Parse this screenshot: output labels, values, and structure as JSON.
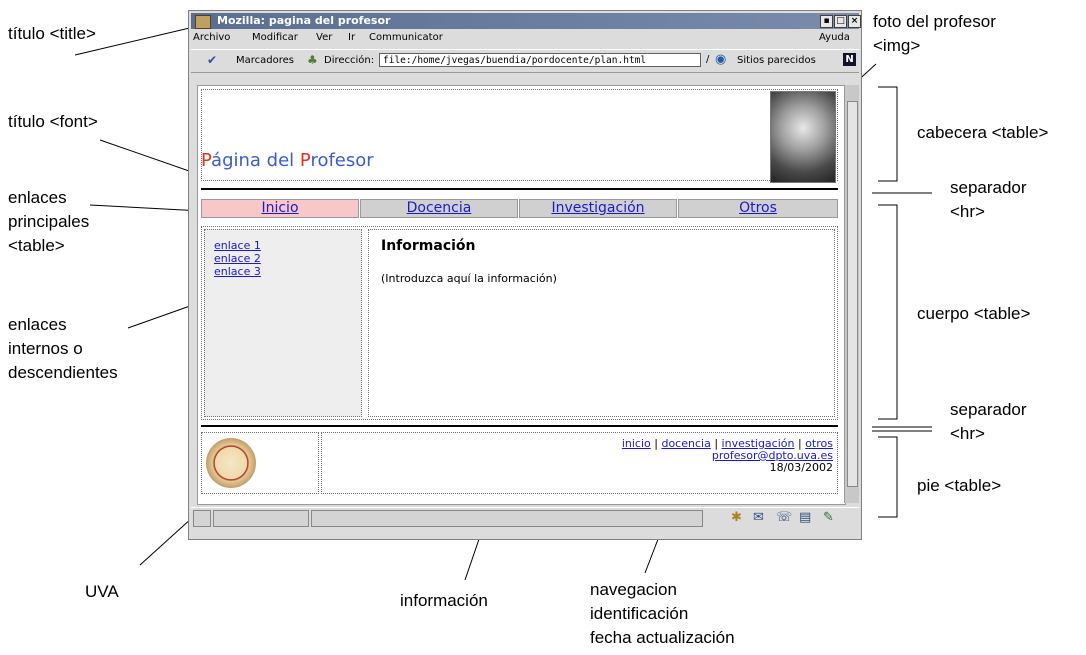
{
  "window": {
    "title": "Mozilla: pagina del profesor",
    "menu": [
      "Archivo",
      "Modificar",
      "Ver",
      "Ir",
      "Communicator"
    ],
    "help": "Ayuda",
    "bookmarks": "Marcadores",
    "address_label": "Dirección:",
    "url": "file:/home/jvegas/buendia/pordocente/plan.html",
    "related": "Sitios parecidos"
  },
  "page": {
    "title_p": "P",
    "title_rest1": "ágina del ",
    "title_p2": "P",
    "title_rest2": "rofesor",
    "nav": [
      "Inicio",
      "Docencia",
      "Investigación",
      "Otros"
    ],
    "side_links": [
      "enlace 1",
      "enlace 2",
      "enlace 3"
    ],
    "info_heading": "Información",
    "info_text": "(Introduzca aquí la información)",
    "footer_links": [
      "inicio",
      "docencia",
      "investigación",
      "otros"
    ],
    "footer_sep": "|",
    "email": "profesor@dpto.uva.es",
    "date": "18/03/2002"
  },
  "annotations": {
    "title_tag": "título <title>",
    "title_font": "título <font>",
    "main_links": [
      "enlaces",
      "principales",
      "<table>"
    ],
    "internal_links": [
      "enlaces",
      "internos o",
      "descendientes"
    ],
    "uva": "UVA",
    "info": "información",
    "nav_id": [
      "navegacion",
      "identificación",
      "fecha actualización"
    ],
    "photo": [
      "foto del profesor",
      "<img>"
    ],
    "header": "cabecera <table>",
    "sep1": [
      "separador",
      "<hr>"
    ],
    "body": "cuerpo <table>",
    "sep2": [
      "separador",
      "<hr>"
    ],
    "footer": "pie <table>"
  }
}
